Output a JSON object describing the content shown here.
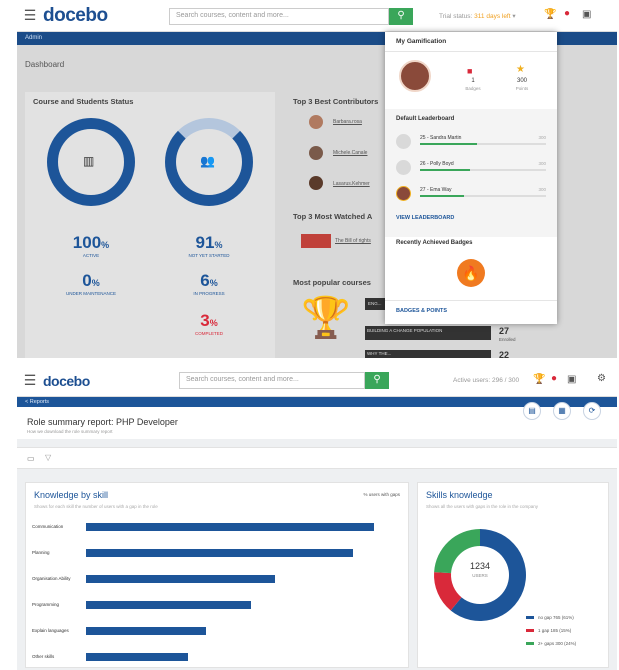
{
  "shot1": {
    "logo": "docebo",
    "search_placeholder": "Search courses, content and more...",
    "search_icon": "search-icon",
    "trial_prefix": "Trial status:",
    "trial_days": "311 days left",
    "bluebar_label": "Admin",
    "page_title": "Dashboard",
    "course_panel_title": "Course and Students Status",
    "stats": [
      {
        "value": "100",
        "unit": "%",
        "label": "Active"
      },
      {
        "value": "91",
        "unit": "%",
        "label": "Not yet started"
      },
      {
        "value": "0",
        "unit": "%",
        "label": "Under maintenance"
      },
      {
        "value": "6",
        "unit": "%",
        "label": "In progress"
      },
      {
        "value": "3",
        "unit": "%",
        "label": "Completed"
      }
    ],
    "contrib_title": "Top 3 Best Contributors",
    "contributors": [
      "Barbara.rosa",
      "Michele.Canale",
      "Lasarus.Kehmer"
    ],
    "watched_title": "Top 3 Most Watched A",
    "watched_item": "The Bill of rights",
    "popular_title": "Most popular courses",
    "popular_items": [
      {
        "name": "ENG...",
        "count": ""
      },
      {
        "name": "BUILDING A CHANGE POPULATION",
        "count": "27",
        "sub": "Enrolled"
      },
      {
        "name": "WHY THE...",
        "count": "22"
      }
    ],
    "popup": {
      "title": "My Gamification",
      "badges_count": "1",
      "badges_label": "Badges",
      "points_count": "300",
      "points_label": "Points",
      "leaderboard_title": "Default Leaderboard",
      "leaderboard": [
        {
          "name": "25 - Sandra Martin",
          "points": "300",
          "fill": 0.45
        },
        {
          "name": "26 - Polly Boyd",
          "points": "300",
          "fill": 0.4
        },
        {
          "name": "27 - Ema Way",
          "points": "300",
          "fill": 0.35
        }
      ],
      "view_leaderboard": "VIEW LEADERBOARD",
      "badges_title": "Recently Achieved Badges",
      "badges_points": "BADGES & POINTS"
    }
  },
  "shot2": {
    "logo": "docebo",
    "search_placeholder": "Search courses, content and more...",
    "active_users": "Active users: 296 / 300",
    "back_label": "< Reports",
    "report_title": "Role summary report: PHP Developer",
    "report_sub": "How we download the role summary report",
    "skill_card": {
      "title": "Knowledge by skill",
      "subtitle": "Shows for each skill the number of users with a gap in the role",
      "legend": "% users with gaps"
    },
    "skills_knowledge": {
      "title": "Skills knowledge",
      "subtitle": "Shows all the users with gaps in the role in the company",
      "center_value": "1234",
      "center_label": "USERS"
    }
  },
  "chart_data": [
    {
      "type": "bar",
      "title": "Knowledge by skill",
      "orientation": "horizontal",
      "categories": [
        "Communication",
        "Planning",
        "Organisation Ability",
        "Programming",
        "Explain languages",
        "Other skills"
      ],
      "values": [
        96,
        89,
        63,
        55,
        40,
        34
      ],
      "xlim": [
        0,
        100
      ],
      "xticks": [
        "0%",
        "10%",
        "20%",
        "30%",
        "40%",
        "50%",
        "60%",
        "70%",
        "80%",
        "90%",
        "100%"
      ],
      "color": "#1d5599"
    },
    {
      "type": "pie",
      "title": "Skills knowledge",
      "center_value": "1234",
      "center_label": "USERS",
      "slices": [
        {
          "label": "no gap 765 (61%)",
          "value": 61,
          "color": "#1d5599"
        },
        {
          "label": "1 gap 185 (15%)",
          "value": 15,
          "color": "#d9293a"
        },
        {
          "label": "2+ gaps 300 (24%)",
          "value": 24,
          "color": "#3aa65a"
        }
      ]
    }
  ]
}
